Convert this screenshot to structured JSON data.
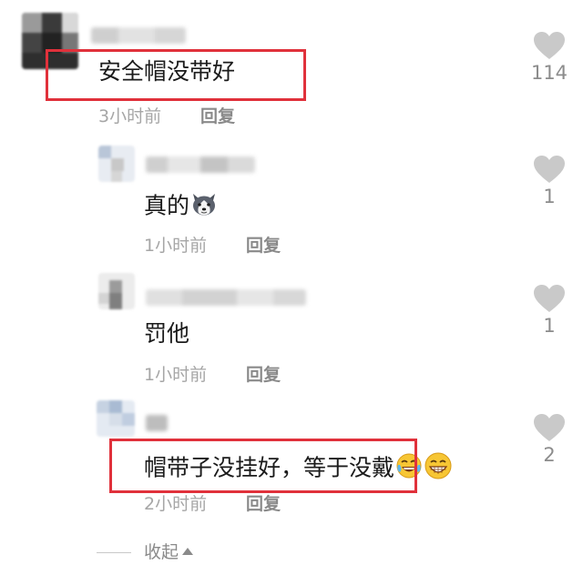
{
  "comments": [
    {
      "text": "安全帽没带好",
      "time": "3小时前",
      "reply_label": "回复",
      "likes": "114"
    },
    {
      "text": "真的",
      "time": "1小时前",
      "reply_label": "回复",
      "likes": "1"
    },
    {
      "text": "罚他",
      "time": "1小时前",
      "reply_label": "回复",
      "likes": "1"
    },
    {
      "text": "帽带子没挂好，等于没戴",
      "time": "2小时前",
      "reply_label": "回复",
      "likes": "2"
    }
  ],
  "collapse_label": "收起",
  "colors": {
    "highlight": "#e0313b",
    "heart": "#c9c9c9",
    "meta": "#a6a6a6"
  },
  "icons": {
    "like": "heart-icon",
    "emoji_1": "husky-dog-emoji",
    "emoji_2": "laughing-tears-emoji",
    "emoji_3": "grinning-face-emoji",
    "collapse": "caret-up-icon"
  }
}
